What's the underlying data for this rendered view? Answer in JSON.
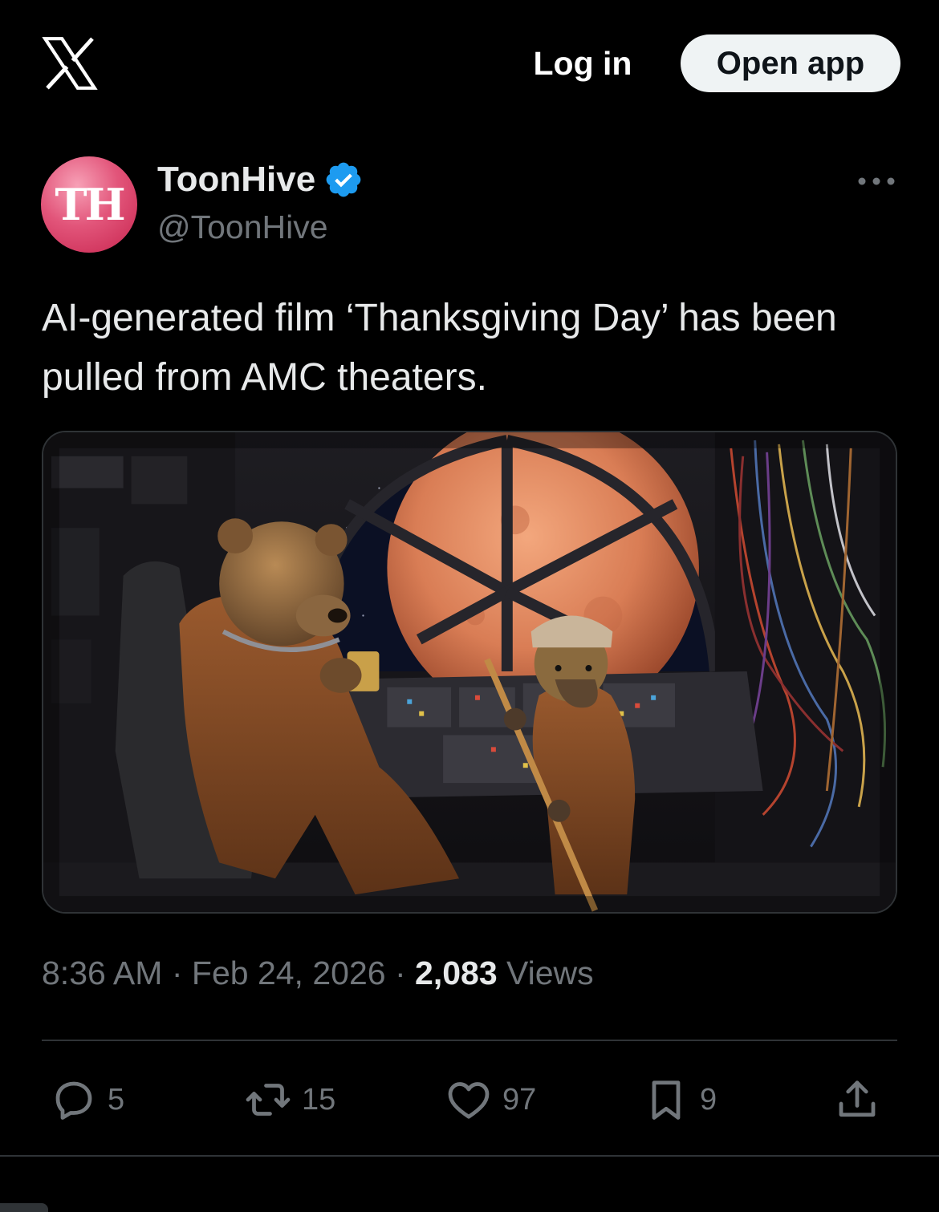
{
  "header": {
    "logo_icon": "x-logo-icon",
    "login_label": "Log in",
    "open_app_label": "Open app"
  },
  "tweet": {
    "avatar_initials": "TH",
    "author_name": "ToonHive",
    "verified": true,
    "handle": "@ToonHive",
    "text": "AI-generated film ‘Thanksgiving Day’ has been pulled from AMC theaters.",
    "time": "8:36 AM",
    "separator": "·",
    "date": "Feb 24, 2026",
    "views_count": "2,083",
    "views_label": "Views"
  },
  "actions": {
    "replies": "5",
    "reposts": "15",
    "likes": "97",
    "bookmarks": "9"
  },
  "colors": {
    "background": "#000000",
    "text_primary": "#e7e9ea",
    "text_secondary": "#71767b",
    "verified_badge": "#1d9bf0",
    "open_app_bg": "#eff3f4",
    "divider": "#2f3336"
  }
}
